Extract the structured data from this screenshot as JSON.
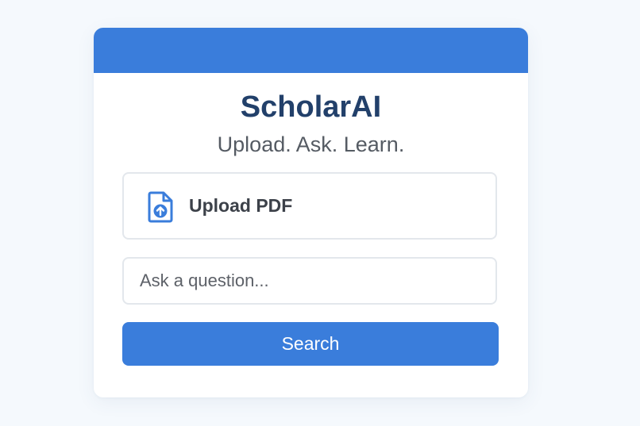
{
  "app": {
    "title": "ScholarAI",
    "tagline": "Upload. Ask. Learn."
  },
  "upload": {
    "label": "Upload PDF",
    "icon": "file-upload-icon"
  },
  "question": {
    "value": "",
    "placeholder": "Ask a question..."
  },
  "search": {
    "label": "Search"
  },
  "colors": {
    "accent": "#3a7ddb",
    "title": "#22406a",
    "background": "#f5f9fd"
  }
}
